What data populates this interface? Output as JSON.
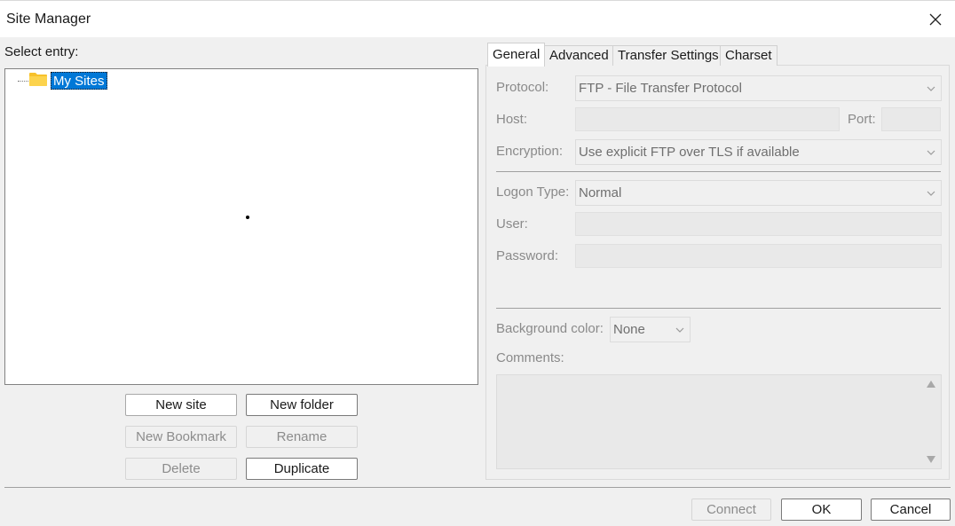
{
  "window": {
    "title": "Site Manager"
  },
  "left": {
    "select_entry_label": "Select entry:",
    "tree": {
      "root_label": "My Sites"
    },
    "buttons": {
      "new_site": "New site",
      "new_folder": "New folder",
      "new_bookmark": "New Bookmark",
      "rename": "Rename",
      "delete": "Delete",
      "duplicate": "Duplicate"
    }
  },
  "tabs": [
    {
      "label": "General",
      "active": true
    },
    {
      "label": "Advanced"
    },
    {
      "label": "Transfer Settings"
    },
    {
      "label": "Charset"
    }
  ],
  "general": {
    "protocol_label": "Protocol:",
    "protocol_value": "FTP - File Transfer Protocol",
    "host_label": "Host:",
    "host_value": "",
    "port_label": "Port:",
    "port_value": "",
    "encryption_label": "Encryption:",
    "encryption_value": "Use explicit FTP over TLS if available",
    "logon_type_label": "Logon Type:",
    "logon_type_value": "Normal",
    "user_label": "User:",
    "user_value": "",
    "password_label": "Password:",
    "password_value": "",
    "background_color_label": "Background color:",
    "background_color_value": "None",
    "comments_label": "Comments:",
    "comments_value": ""
  },
  "footer": {
    "connect": "Connect",
    "ok": "OK",
    "cancel": "Cancel"
  },
  "icons": {
    "close": "close-icon",
    "folder": "folder-icon",
    "dropdown": "chevron-down-icon"
  },
  "colors": {
    "selection": "#0078d7",
    "folder": "#f7c12b"
  }
}
